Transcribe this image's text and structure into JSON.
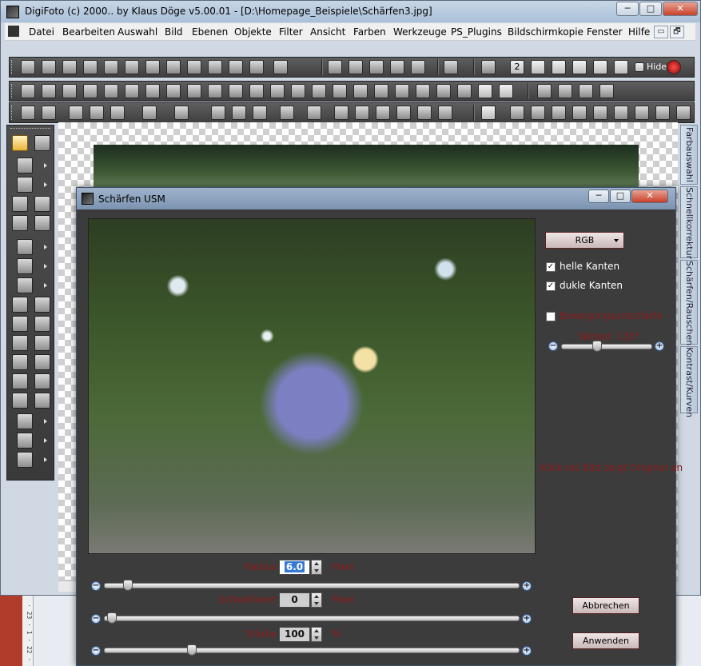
{
  "main_window": {
    "title": "DigiFoto (c) 2000.. by Klaus Döge v5.00.01 - [D:\\Homepage_Beispiele\\Schärfen3.jpg]",
    "controls": {
      "minimize": "─",
      "maximize": "□",
      "close": "✕"
    }
  },
  "menu": {
    "items": [
      {
        "label": "Datei"
      },
      {
        "label": "Bearbeiten"
      },
      {
        "label": "Auswahl"
      },
      {
        "label": "Bild"
      },
      {
        "label": "Ebenen"
      },
      {
        "label": "Objekte"
      },
      {
        "label": "Filter"
      },
      {
        "label": "Ansicht"
      },
      {
        "label": "Farben"
      },
      {
        "label": "Werkzeuge"
      },
      {
        "label": "PS_Plugins"
      },
      {
        "label": "Bildschirmkopie"
      },
      {
        "label": "Fenster"
      },
      {
        "label": "Hilfe"
      }
    ],
    "mdi_controls": {
      "restore": "▭",
      "max": "🗗"
    }
  },
  "toolbar": {
    "hide_label": "Hide",
    "layer_count": "2"
  },
  "side_tabs": [
    "Farbauswahl",
    "Schnellkorrektur",
    "Schärfen/Rauschen",
    "Kontrast/Kurven"
  ],
  "dialog": {
    "title": "Schärfen USM",
    "controls": {
      "minimize": "─",
      "maximize": "□",
      "close": "✕"
    },
    "channel_select": "RGB",
    "helle_kanten": {
      "label": "helle Kanten",
      "checked": true
    },
    "dunkle_kanten": {
      "label": "dukle Kanten",
      "checked": true
    },
    "bewegung": {
      "label": "Bewegungsunschärfe",
      "checked": false
    },
    "winkel": {
      "label": "Winkel: 135°",
      "value": 135
    },
    "hint": "Klick ins Bild zeigt Original an",
    "radius": {
      "label": "Radius",
      "value": "6.0",
      "unit": "Pixel",
      "level": 0.04
    },
    "schwellwert": {
      "label": "Schwellwert",
      "value": "0",
      "unit": "Pixel",
      "level": 0.0
    },
    "staerke": {
      "label": "Stärke",
      "value": "100",
      "unit": "%",
      "level": 0.2
    },
    "cancel_label": "Abbrechen",
    "apply_label": "Anwenden"
  },
  "background": {
    "ruler_text": "· 23 · 1 · 22 ·",
    "letter": "t"
  }
}
